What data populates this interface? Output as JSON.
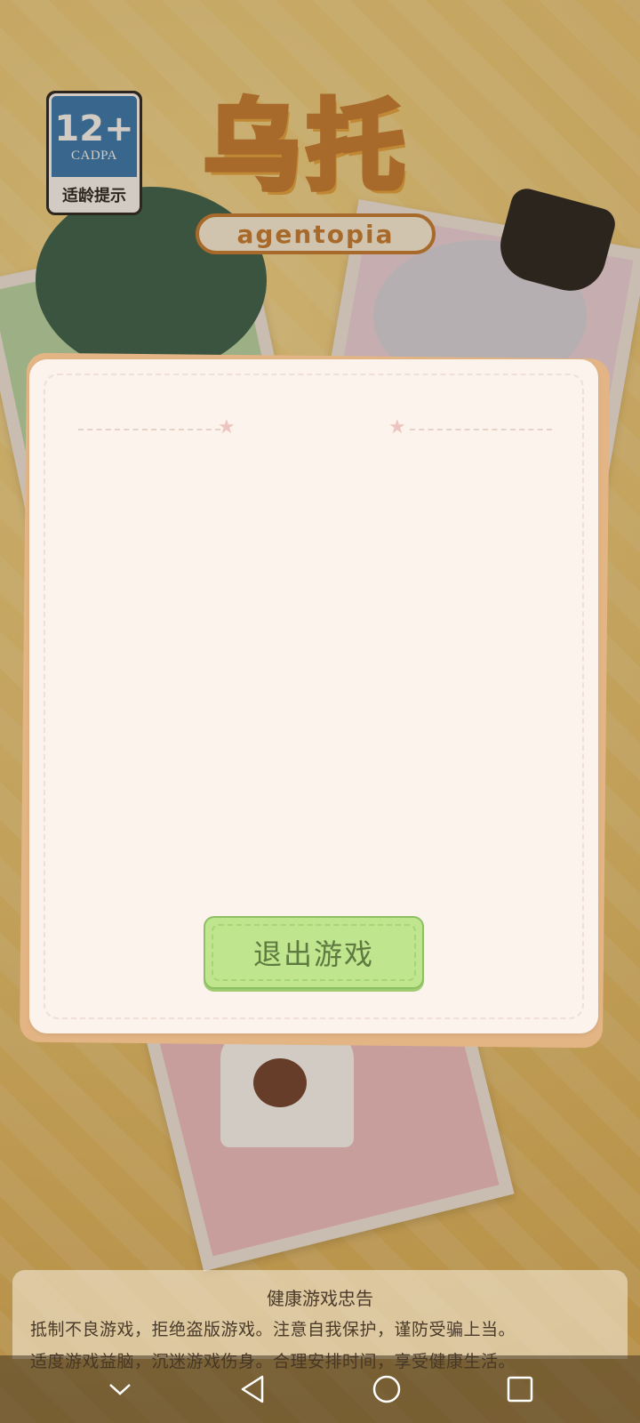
{
  "age_badge": {
    "rating": "12+",
    "org": "CADPA",
    "caption": "适龄提示"
  },
  "logo": {
    "title_part1": "乌",
    "title_part2": "托",
    "subtitle": "agentopia"
  },
  "dialog": {
    "exit_button_label": "退出游戏"
  },
  "health_notice": {
    "title": "健康游戏忠告",
    "line1": "抵制不良游戏，拒绝盗版游戏。注意自我保护，谨防受骗上当。",
    "line2": "适度游戏益脑，沉迷游戏伤身。合理安排时间，享受健康生活。"
  },
  "navbar": {
    "icons": [
      "chevron-down-icon",
      "back-icon",
      "home-icon",
      "recents-icon"
    ]
  },
  "colors": {
    "dialog_bg": "#fcf3ed",
    "button_green": "#bfe58e",
    "badge_blue": "#2b73b5"
  }
}
